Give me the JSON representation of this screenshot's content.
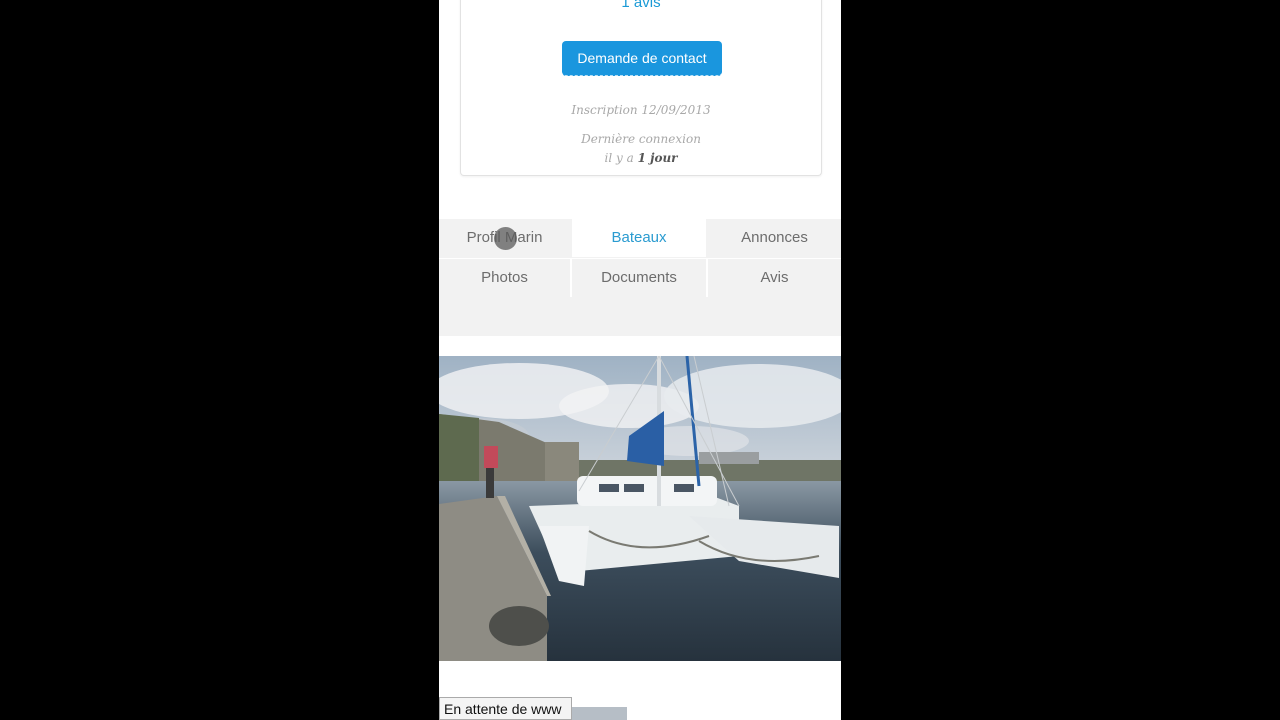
{
  "profile": {
    "reviews_link": "1 avis",
    "contact_button": "Demande de contact",
    "inscription": "Inscription 12/09/2013",
    "last_login_label": "Dernière connexion",
    "last_login_prefix": "il y a",
    "last_login_value": "1 jour"
  },
  "tabs": [
    {
      "label": "Profil Marin",
      "active": false
    },
    {
      "label": "Bateaux",
      "active": true
    },
    {
      "label": "Annonces",
      "active": false
    },
    {
      "label": "Photos",
      "active": false
    },
    {
      "label": "Documents",
      "active": false
    },
    {
      "label": "Avis",
      "active": false
    }
  ],
  "status_bar": {
    "text": "En attente de www"
  },
  "colors": {
    "accent": "#1a96de",
    "active_tab": "#2a9bd0",
    "tab_bg": "#f2f2f2"
  }
}
